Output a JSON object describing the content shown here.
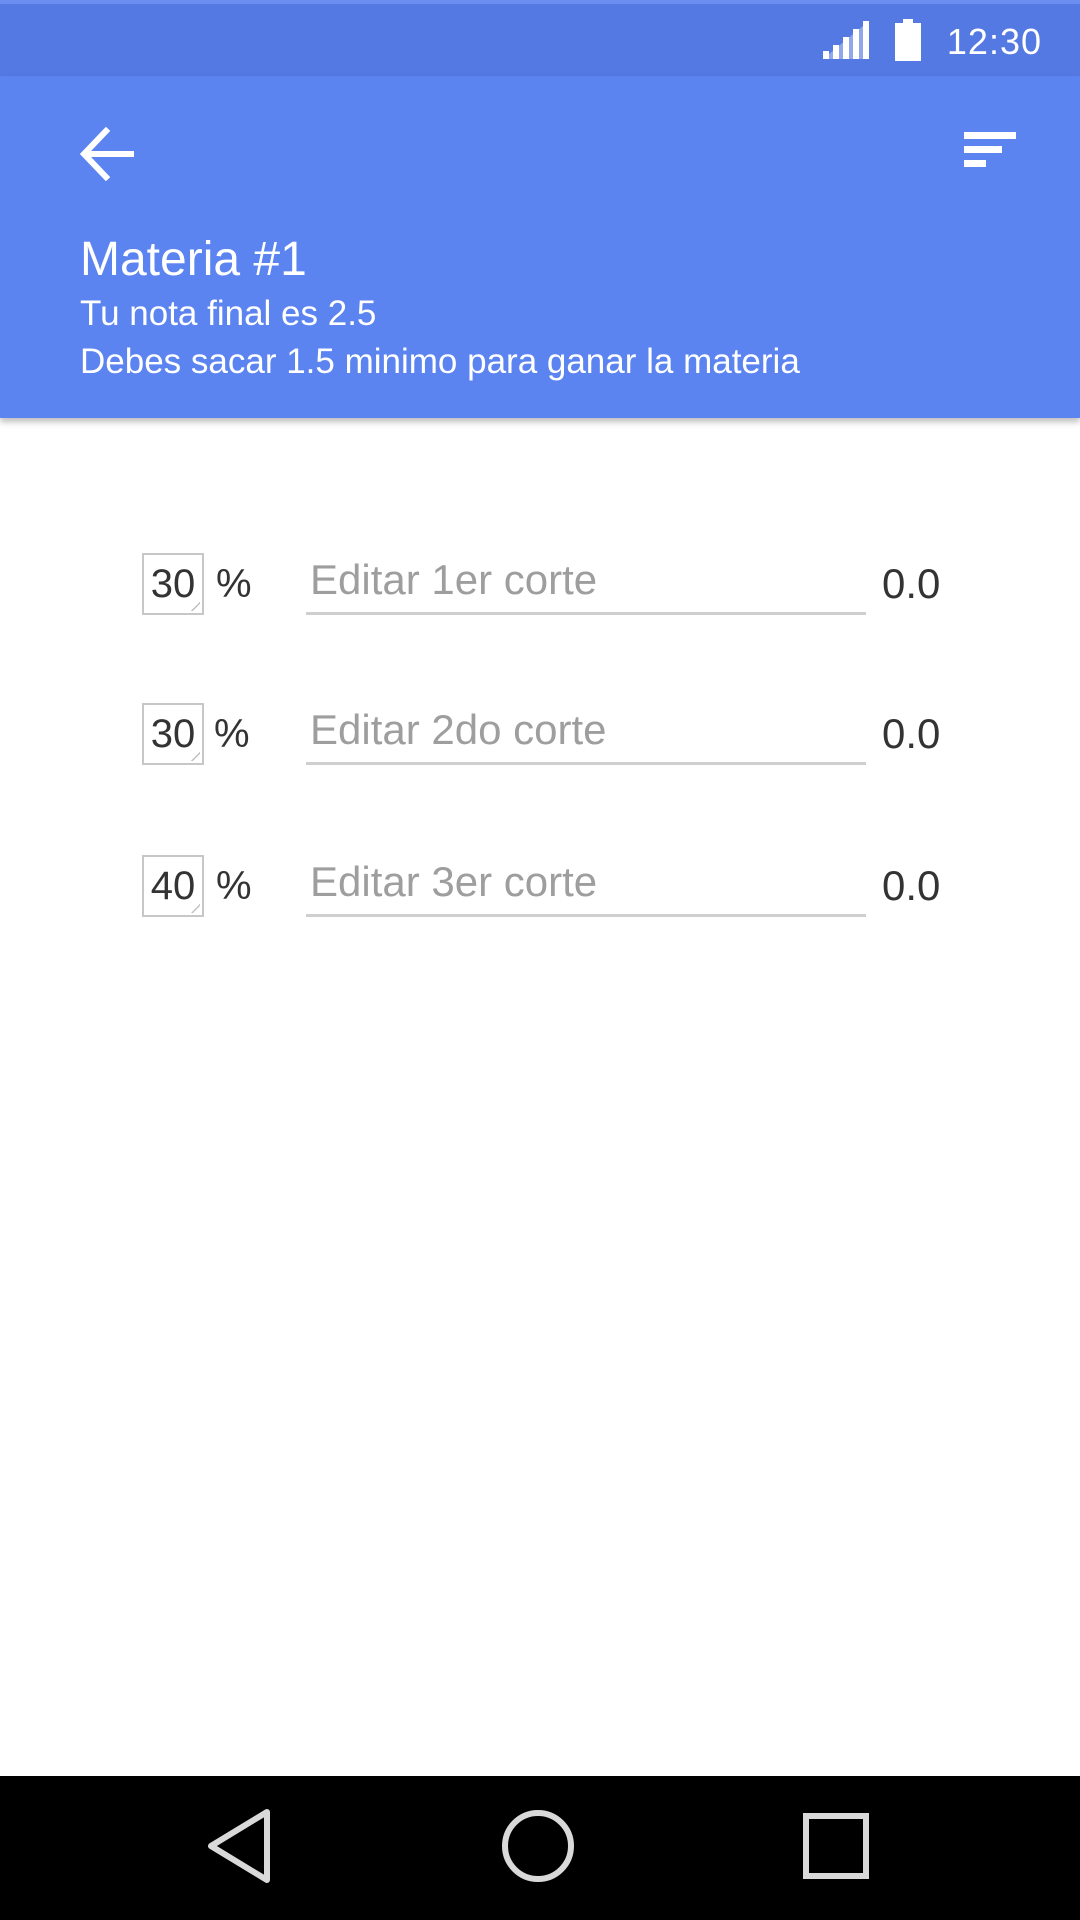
{
  "status_bar": {
    "time": "12:30",
    "icons": [
      "signal-icon",
      "battery-icon"
    ]
  },
  "app_bar": {
    "back_icon": "arrow-back-icon",
    "sort_icon": "sort-icon",
    "title": "Materia #1",
    "subtitle_1": "Tu nota final es 2.5",
    "subtitle_2": "Debes sacar 1.5 minimo para ganar la materia"
  },
  "cortes": [
    {
      "percent": "30",
      "percent_sign": "%",
      "placeholder": "Editar 1er corte",
      "grade": "0.0"
    },
    {
      "percent": "30",
      "percent_sign": "%",
      "placeholder": "Editar 2do corte",
      "grade": "0.0"
    },
    {
      "percent": "40",
      "percent_sign": "%",
      "placeholder": "Editar 3er corte",
      "grade": "0.0"
    }
  ],
  "nav_bar": {
    "icons": [
      "nav-back-icon",
      "nav-home-icon",
      "nav-recents-icon"
    ]
  },
  "colors": {
    "status_bar": "#5579e2",
    "app_bar": "#5b84f0",
    "nav_bar": "#000000"
  }
}
